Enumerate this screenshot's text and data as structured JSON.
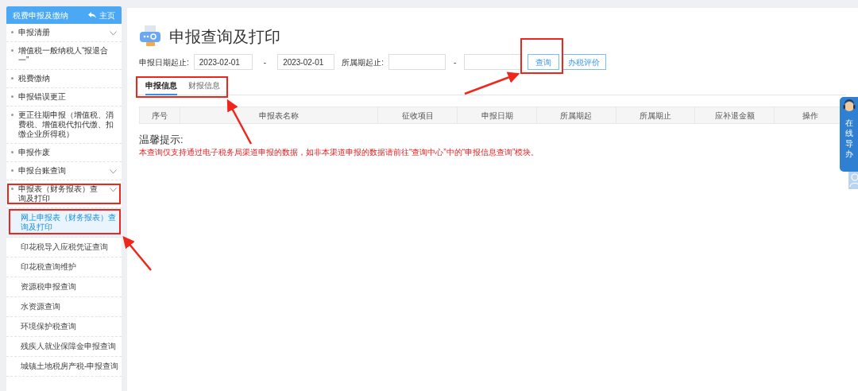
{
  "sidebar": {
    "title": "税费申报及缴纳",
    "home_label": "主页",
    "items": [
      {
        "label": "申报清册",
        "expandable": true,
        "expanded": false
      },
      {
        "label": "增值税一般纳税人“报退合一”",
        "expandable": false
      },
      {
        "label": "税费缴纳",
        "expandable": false
      },
      {
        "label": "申报错误更正",
        "expandable": false
      },
      {
        "label": "更正往期申报（增值税、消费税、增值税代扣代缴、扣缴企业所得税）",
        "expandable": false
      },
      {
        "label": "申报作废",
        "expandable": false
      },
      {
        "label": "申报台账查询",
        "expandable": true,
        "expanded": false
      },
      {
        "label": "申报表（财务报表）查询及打印",
        "expandable": true,
        "expanded": true,
        "children": [
          {
            "label": "网上申报表（财务报表）查询及打印",
            "selected": true
          },
          {
            "label": "印花税导入应税凭证查询",
            "selected": false
          },
          {
            "label": "印花税查询维护",
            "selected": false
          },
          {
            "label": "资源税申报查询",
            "selected": false
          },
          {
            "label": "水资源查询",
            "selected": false
          },
          {
            "label": "环境保护税查询",
            "selected": false
          },
          {
            "label": "残疾人就业保障金申报查询",
            "selected": false
          },
          {
            "label": "城镇土地税房产税-申报查询",
            "selected": false
          }
        ]
      }
    ]
  },
  "page": {
    "title": "申报查询及打印",
    "filters": {
      "date_label": "申报日期起止:",
      "date_from": "2023-02-01",
      "date_sep": "-",
      "date_to": "2023-02-01",
      "period_label": "所属期起止:",
      "period_sep": "-"
    },
    "buttons": [
      "查询",
      "办税评价"
    ],
    "tabs": [
      {
        "label": "申报信息",
        "selected": true
      },
      {
        "label": "财报信息",
        "selected": false
      }
    ],
    "table": {
      "columns": [
        "序号",
        "申报表名称",
        "征收项目",
        "申报日期",
        "所属期起",
        "所属期止",
        "应补退金额",
        "操作"
      ]
    },
    "tips_title": "温馨提示:",
    "tips_text": "本查询仅支持通过电子税务局渠道申报的数据，如非本渠道申报的数据请前往“查询中心”中的“申报信息查询”模块。"
  },
  "side_widget": {
    "label": "在线导办"
  }
}
